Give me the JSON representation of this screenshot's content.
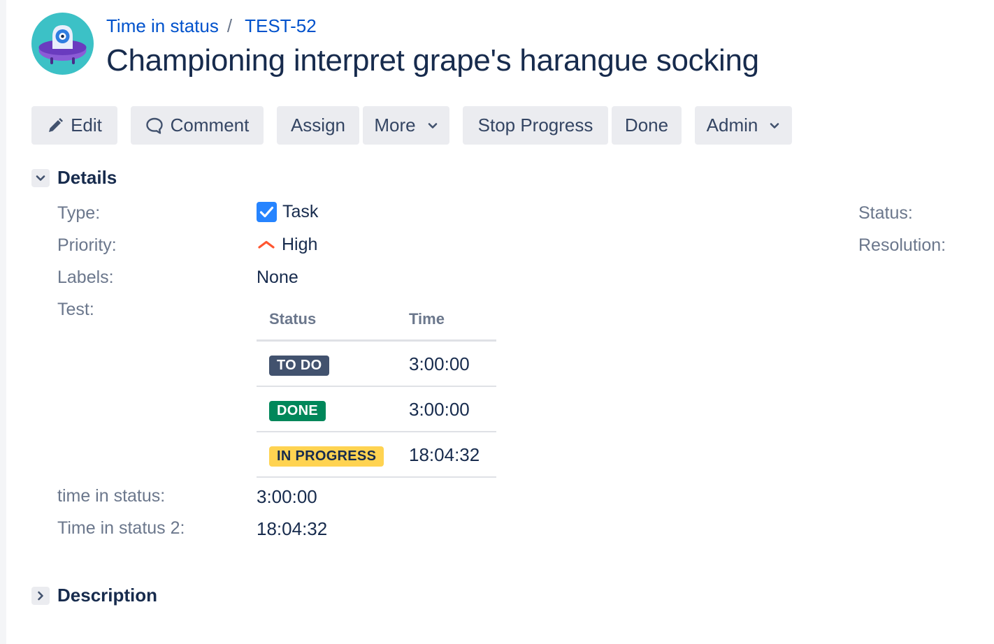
{
  "breadcrumb": {
    "project": "Time in status",
    "separator": "/",
    "issue_key": "TEST-52"
  },
  "issue": {
    "title": "Championing interpret grape's harangue socking"
  },
  "toolbar": {
    "edit": "Edit",
    "comment": "Comment",
    "assign": "Assign",
    "more": "More",
    "stop_progress": "Stop Progress",
    "done": "Done",
    "admin": "Admin"
  },
  "details": {
    "title": "Details",
    "type": {
      "label": "Type:",
      "value": "Task",
      "icon": "task-checkbox-icon"
    },
    "priority": {
      "label": "Priority:",
      "value": "High",
      "icon": "priority-high-icon"
    },
    "labels": {
      "label": "Labels:",
      "value": "None"
    },
    "test": {
      "label": "Test:",
      "table": {
        "headers": [
          "Status",
          "Time"
        ],
        "rows": [
          {
            "status": "TO DO",
            "time": "3:00:00",
            "bg": "#42526e",
            "fg": "#ffffff"
          },
          {
            "status": "DONE",
            "time": "3:00:00",
            "bg": "#00875a",
            "fg": "#ffffff"
          },
          {
            "status": "IN PROGRESS",
            "time": "18:04:32",
            "bg": "#ffd351",
            "fg": "#172b4d"
          }
        ]
      }
    },
    "time_in_status": {
      "label": "time in status:",
      "value": "3:00:00"
    },
    "time_in_status_2": {
      "label": "Time in status 2:",
      "value": "18:04:32"
    },
    "status_label": "Status:",
    "resolution_label": "Resolution:"
  },
  "description": {
    "title": "Description"
  },
  "colors": {
    "link": "#0052cc",
    "text": "#172b4d",
    "muted": "#6b778c",
    "button_bg": "#ebecf0"
  }
}
